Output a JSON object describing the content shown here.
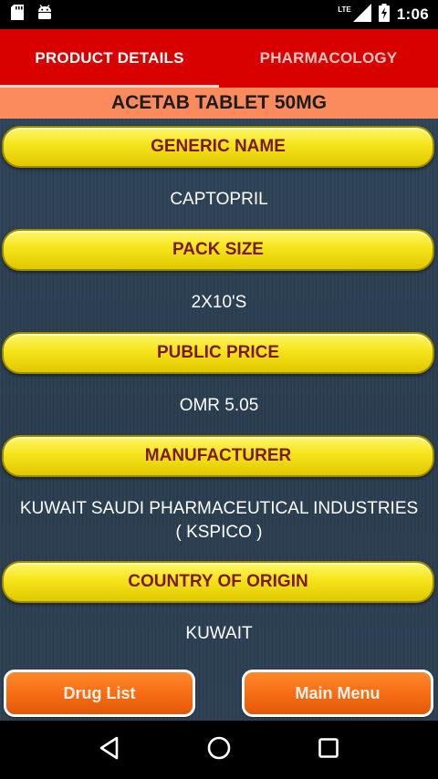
{
  "status_bar": {
    "time": "1:06",
    "network": "LTE",
    "icons": [
      "sd-card-icon",
      "android-icon",
      "lte-signal-icon",
      "battery-charging-icon"
    ]
  },
  "tabs": [
    {
      "label": "PRODUCT DETAILS",
      "active": true
    },
    {
      "label": "PHARMACOLOGY",
      "active": false
    }
  ],
  "product": {
    "title": "ACETAB TABLET 50MG",
    "fields": [
      {
        "label": "GENERIC NAME",
        "value": "CAPTOPRIL"
      },
      {
        "label": "PACK SIZE",
        "value": "2X10'S"
      },
      {
        "label": "PUBLIC PRICE",
        "value": "OMR 5.05"
      },
      {
        "label": "MANUFACTURER",
        "value_lines": [
          "KUWAIT SAUDI PHARMACEUTICAL INDUSTRIES",
          "( KSPICO )"
        ]
      },
      {
        "label": "COUNTRY OF ORIGIN",
        "value": "KUWAIT"
      }
    ]
  },
  "buttons": {
    "drug_list": "Drug List",
    "main_menu": "Main Menu"
  },
  "nav": {
    "icons": [
      "back-triangle-icon",
      "home-circle-icon",
      "recents-square-icon"
    ]
  },
  "colors": {
    "tab_bar": "#d90000",
    "title_banner": "#fb8a5c",
    "field_header": "#f5e41a",
    "field_header_text": "#7b1a14",
    "content_bg": "#2d4154",
    "action_button": "#f66a12"
  }
}
